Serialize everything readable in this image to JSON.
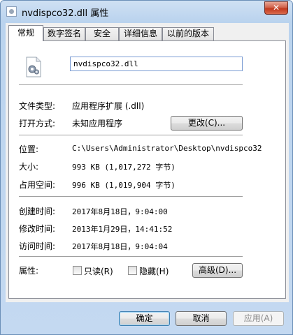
{
  "window": {
    "title": "nvdispco32.dll 属性",
    "close_glyph": "✕"
  },
  "tabs": [
    {
      "label": "常规",
      "active": true
    },
    {
      "label": "数字签名",
      "active": false
    },
    {
      "label": "安全",
      "active": false
    },
    {
      "label": "详细信息",
      "active": false
    },
    {
      "label": "以前的版本",
      "active": false
    }
  ],
  "general": {
    "file_name": "nvdispco32.dll",
    "file_type_label": "文件类型:",
    "file_type_value": "应用程序扩展 (.dll)",
    "open_with_label": "打开方式:",
    "open_with_value": "未知应用程序",
    "change_button": "更改(C)...",
    "location_label": "位置:",
    "location_value": "C:\\Users\\Administrator\\Desktop\\nvdispco32",
    "size_label": "大小:",
    "size_value": "993 KB (1,017,272 字节)",
    "size_on_disk_label": "占用空间:",
    "size_on_disk_value": "996 KB (1,019,904 字节)",
    "created_label": "创建时间:",
    "created_value": "2017年8月18日，9:04:00",
    "modified_label": "修改时间:",
    "modified_value": "2013年1月29日，14:41:52",
    "accessed_label": "访问时间:",
    "accessed_value": "2017年8月18日，9:04:04",
    "attributes_label": "属性:",
    "readonly_label": "只读(R)",
    "readonly_checked": false,
    "hidden_label": "隐藏(H)",
    "hidden_checked": false,
    "advanced_button": "高级(D)..."
  },
  "footer": {
    "ok_button": "确定",
    "cancel_button": "取消",
    "apply_button": "应用(A)"
  }
}
